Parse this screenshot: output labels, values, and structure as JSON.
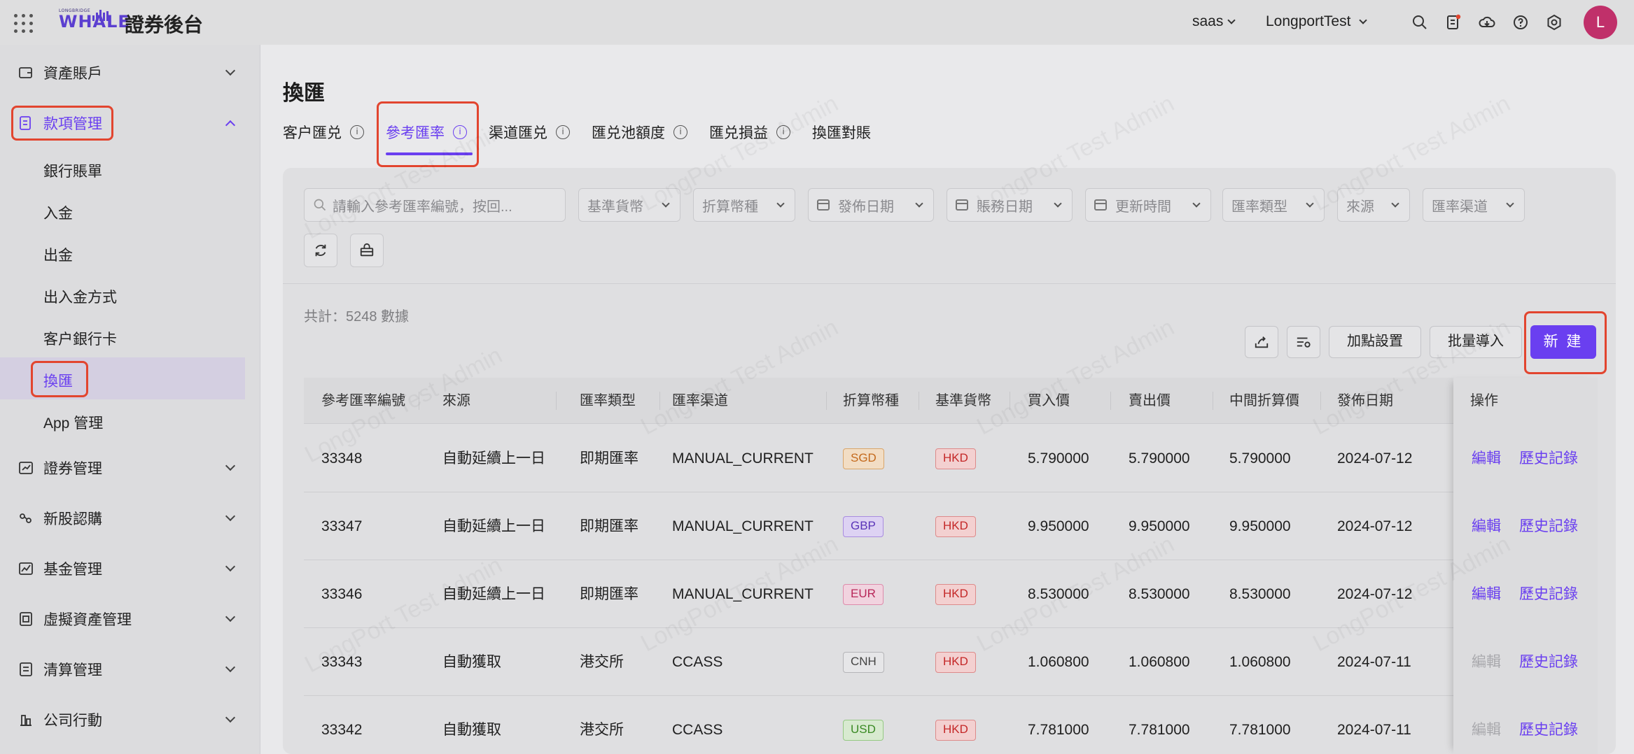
{
  "header": {
    "logo_small": "LONGBRIDGE",
    "logo_big": "WHALE",
    "app_title": "證券後台",
    "tenant": "saas",
    "environment": "LongportTest",
    "avatar_initial": "L",
    "icons": [
      "search-icon",
      "document-icon",
      "cloud-download-icon",
      "help-icon",
      "settings-icon"
    ]
  },
  "sidebar": {
    "items": [
      {
        "label": "資產賬戶",
        "icon": "wallet-icon"
      },
      {
        "label": "款項管理",
        "icon": "ledger-icon"
      },
      {
        "label": "證券管理",
        "icon": "chart-box-icon"
      },
      {
        "label": "新股認購",
        "icon": "ipo-icon"
      },
      {
        "label": "基金管理",
        "icon": "fund-icon"
      },
      {
        "label": "虛擬資產管理",
        "icon": "crypto-icon"
      },
      {
        "label": "清算管理",
        "icon": "clearing-icon"
      },
      {
        "label": "公司行動",
        "icon": "corporate-action-icon"
      }
    ],
    "sub_items": [
      "銀行賬單",
      "入金",
      "出金",
      "出入金方式",
      "客户銀行卡",
      "換匯",
      "App 管理"
    ]
  },
  "main": {
    "title": "換匯",
    "tabs": [
      {
        "label": "客户匯兑"
      },
      {
        "label": "參考匯率"
      },
      {
        "label": "渠道匯兑"
      },
      {
        "label": "匯兑池額度"
      },
      {
        "label": "匯兑損益"
      },
      {
        "label": "換匯對賬"
      }
    ],
    "filters": {
      "search_placeholder": "請輸入參考匯率編號，按回...",
      "base_currency": "基準貨幣",
      "convert_currency": "折算幣種",
      "publish_date": "發佈日期",
      "account_date": "賬務日期",
      "update_time": "更新時間",
      "rate_type": "匯率類型",
      "source": "來源",
      "rate_channel": "匯率渠道"
    },
    "total": "共計：5248 數據",
    "toolbar": {
      "markup_settings": "加點設置",
      "batch_import": "批量導入",
      "new": "新 建"
    },
    "table": {
      "columns": [
        "參考匯率編號",
        "來源",
        "匯率類型",
        "匯率渠道",
        "折算幣種",
        "基準貨幣",
        "買入價",
        "賣出價",
        "中間折算價",
        "發佈日期",
        "操作"
      ],
      "rows": [
        {
          "id": "33348",
          "source": "自動延續上一日",
          "type": "即期匯率",
          "channel": "MANUAL_CURRENT",
          "convert": "SGD",
          "base": "HKD",
          "buy": "5.790000",
          "sell": "5.790000",
          "mid": "5.790000",
          "date": "2024-07-12",
          "edit": "編輯",
          "history": "歷史記錄",
          "edit_enabled": true
        },
        {
          "id": "33347",
          "source": "自動延續上一日",
          "type": "即期匯率",
          "channel": "MANUAL_CURRENT",
          "convert": "GBP",
          "base": "HKD",
          "buy": "9.950000",
          "sell": "9.950000",
          "mid": "9.950000",
          "date": "2024-07-12",
          "edit": "編輯",
          "history": "歷史記錄",
          "edit_enabled": true
        },
        {
          "id": "33346",
          "source": "自動延續上一日",
          "type": "即期匯率",
          "channel": "MANUAL_CURRENT",
          "convert": "EUR",
          "base": "HKD",
          "buy": "8.530000",
          "sell": "8.530000",
          "mid": "8.530000",
          "date": "2024-07-12",
          "edit": "編輯",
          "history": "歷史記錄",
          "edit_enabled": true
        },
        {
          "id": "33343",
          "source": "自動獲取",
          "type": "港交所",
          "channel": "CCASS",
          "convert": "CNH",
          "base": "HKD",
          "buy": "1.060800",
          "sell": "1.060800",
          "mid": "1.060800",
          "date": "2024-07-11",
          "edit": "編輯",
          "history": "歷史記錄",
          "edit_enabled": false
        },
        {
          "id": "33342",
          "source": "自動獲取",
          "type": "港交所",
          "channel": "CCASS",
          "convert": "USD",
          "base": "HKD",
          "buy": "7.781000",
          "sell": "7.781000",
          "mid": "7.781000",
          "date": "2024-07-11",
          "edit": "編輯",
          "history": "歷史記錄",
          "edit_enabled": false
        }
      ]
    },
    "watermark": "LongPort Test Admin"
  },
  "colors": {
    "accent": "#6a3ff0",
    "highlight": "#e2452f",
    "avatar": "#c0306a"
  }
}
